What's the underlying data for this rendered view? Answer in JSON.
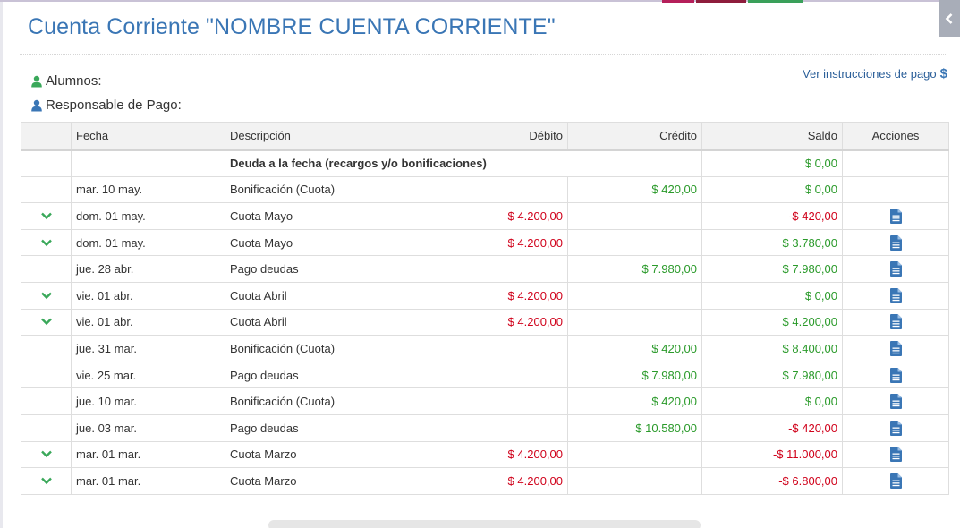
{
  "page": {
    "title": "Cuenta Corriente \"NOMBRE CUENTA CORRIENTE\"",
    "alumnos_label": "Alumnos:",
    "responsable_label": "Responsable de Pago:",
    "pay_link_label": "Ver instrucciones de pago",
    "pay_link_icon": "$"
  },
  "icons": {
    "side_toggle": "chevron-left-icon",
    "alumnos": "user-icon",
    "responsable": "user-icon",
    "row_expand": "chevron-down-icon",
    "row_action": "document-icon"
  },
  "colors": {
    "title": "#3a76b5",
    "debit": "#d0021b",
    "credit": "#2a9a2a",
    "icon_blue": "#3a76b5",
    "icon_green": "#3aa85a"
  },
  "table": {
    "headers": {
      "expand": "",
      "fecha": "Fecha",
      "descripcion": "Descripción",
      "debito": "Débito",
      "credito": "Crédito",
      "saldo": "Saldo",
      "acciones": "Acciones"
    },
    "summary": {
      "descripcion": "Deuda a la fecha (recargos y/o bonificaciones)",
      "saldo": "$ 0,00",
      "saldo_sign": "pos"
    },
    "rows": [
      {
        "expand": false,
        "fecha": "mar. 10 may.",
        "descripcion": "Bonificación (Cuota)",
        "debito": "",
        "credito": "$ 420,00",
        "saldo": "$ 0,00",
        "saldo_sign": "pos",
        "action": false
      },
      {
        "expand": true,
        "fecha": "dom. 01 may.",
        "descripcion": "Cuota Mayo",
        "debito": "$ 4.200,00",
        "credito": "",
        "saldo": "-$ 420,00",
        "saldo_sign": "neg",
        "action": true
      },
      {
        "expand": true,
        "fecha": "dom. 01 may.",
        "descripcion": "Cuota Mayo",
        "debito": "$ 4.200,00",
        "credito": "",
        "saldo": "$ 3.780,00",
        "saldo_sign": "pos",
        "action": true
      },
      {
        "expand": false,
        "fecha": "jue. 28 abr.",
        "descripcion": "Pago deudas",
        "debito": "",
        "credito": "$ 7.980,00",
        "saldo": "$ 7.980,00",
        "saldo_sign": "pos",
        "action": true
      },
      {
        "expand": true,
        "fecha": "vie. 01 abr.",
        "descripcion": "Cuota Abril",
        "debito": "$ 4.200,00",
        "credito": "",
        "saldo": "$ 0,00",
        "saldo_sign": "pos",
        "action": true
      },
      {
        "expand": true,
        "fecha": "vie. 01 abr.",
        "descripcion": "Cuota Abril",
        "debito": "$ 4.200,00",
        "credito": "",
        "saldo": "$ 4.200,00",
        "saldo_sign": "pos",
        "action": true
      },
      {
        "expand": false,
        "fecha": "jue. 31 mar.",
        "descripcion": "Bonificación (Cuota)",
        "debito": "",
        "credito": "$ 420,00",
        "saldo": "$ 8.400,00",
        "saldo_sign": "pos",
        "action": true
      },
      {
        "expand": false,
        "fecha": "vie. 25 mar.",
        "descripcion": "Pago deudas",
        "debito": "",
        "credito": "$ 7.980,00",
        "saldo": "$ 7.980,00",
        "saldo_sign": "pos",
        "action": true
      },
      {
        "expand": false,
        "fecha": "jue. 10 mar.",
        "descripcion": "Bonificación (Cuota)",
        "debito": "",
        "credito": "$ 420,00",
        "saldo": "$ 0,00",
        "saldo_sign": "pos",
        "action": true
      },
      {
        "expand": false,
        "fecha": "jue. 03 mar.",
        "descripcion": "Pago deudas",
        "debito": "",
        "credito": "$ 10.580,00",
        "saldo": "-$ 420,00",
        "saldo_sign": "neg",
        "action": true
      },
      {
        "expand": true,
        "fecha": "mar. 01 mar.",
        "descripcion": "Cuota Marzo",
        "debito": "$ 4.200,00",
        "credito": "",
        "saldo": "-$ 11.000,00",
        "saldo_sign": "neg",
        "action": true
      },
      {
        "expand": true,
        "fecha": "mar. 01 mar.",
        "descripcion": "Cuota Marzo",
        "debito": "$ 4.200,00",
        "credito": "",
        "saldo": "-$ 6.800,00",
        "saldo_sign": "neg",
        "action": true
      }
    ]
  }
}
